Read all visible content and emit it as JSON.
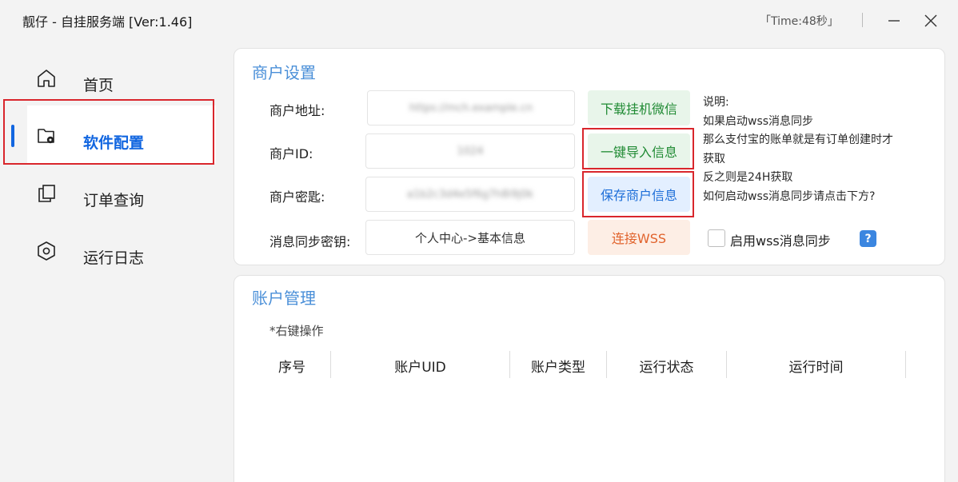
{
  "window": {
    "title": "靓仔 - 自挂服务端  [Ver:1.46]",
    "timer": "「Time:48秒」"
  },
  "sidebar": {
    "items": [
      {
        "label": "首页",
        "icon": "home-icon",
        "active": false
      },
      {
        "label": "软件配置",
        "icon": "folder-settings-icon",
        "active": true
      },
      {
        "label": "订单查询",
        "icon": "copy-icon",
        "active": false
      },
      {
        "label": "运行日志",
        "icon": "hexagon-icon",
        "active": false
      }
    ]
  },
  "merchant": {
    "title": "商户设置",
    "address_label": "商户地址:",
    "address_value": "https://mch.example.cn",
    "id_label": "商户ID:",
    "id_value": "1024",
    "key_label": "商户密匙:",
    "key_value": "a1b2c3d4e5f6g7h8i9j0k",
    "sync_key_label": "消息同步密钥:",
    "sync_key_placeholder": "个人中心->基本信息",
    "btn_download": "下载挂机微信",
    "btn_import": "一键导入信息",
    "btn_save": "保存商户信息",
    "btn_connect": "连接WSS",
    "note_lines": [
      "说明:",
      "如果启动wss消息同步",
      "那么支付宝的账单就是有订单创建时才",
      "获取",
      "反之则是24H获取",
      "如何启动wss消息同步请点击下方?"
    ],
    "wss_checkbox_label": "启用wss消息同步",
    "wss_checked": false,
    "help_label": "?"
  },
  "accounts": {
    "title": "账户管理",
    "hint": "*右键操作",
    "columns": [
      "序号",
      "账户UID",
      "账户类型",
      "运行状态",
      "运行时间"
    ]
  },
  "colors": {
    "accent": "#1266e0",
    "highlight_border": "#d9262c",
    "panel_title": "#4a8fd8"
  }
}
